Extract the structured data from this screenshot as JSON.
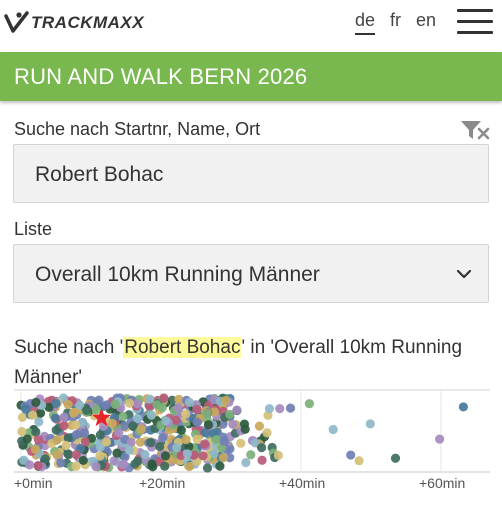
{
  "header": {
    "logo_text": "TRACKMAXX",
    "languages": [
      {
        "code": "de",
        "active": true
      },
      {
        "code": "fr",
        "active": false
      },
      {
        "code": "en",
        "active": false
      }
    ],
    "menu_icon": "hamburger-menu-icon"
  },
  "event": {
    "title": "RUN AND WALK BERN 2026",
    "accent_color": "#79b84f"
  },
  "search": {
    "label": "Suche nach Startnr, Name, Ort",
    "value": "Robert Bohac",
    "filter_icon": "filter-icon"
  },
  "list": {
    "label": "Liste",
    "selected": "Overall 10km Running Männer",
    "chevron_icon": "chevron-down-icon"
  },
  "result": {
    "prefix": "Suche nach '",
    "query": "Robert Bohac",
    "middle": "' in '",
    "list_name": "Overall 10km Running Männer",
    "suffix": "'",
    "highlight_color": "#fffa9c"
  },
  "chart_data": {
    "type": "scatter",
    "xlabel": "",
    "ylabel": "",
    "xlim": [
      -1,
      67
    ],
    "x_ticks": [
      {
        "value": 0,
        "label": "+0min"
      },
      {
        "value": 20,
        "label": "+20min"
      },
      {
        "value": 40,
        "label": "+40min"
      },
      {
        "value": 60,
        "label": "+60min"
      }
    ],
    "highlight": {
      "x": 11.5,
      "marker": "star",
      "color": "#e8232a"
    },
    "dot_colors": [
      "#4a7a9c",
      "#c9a85c",
      "#7bb07a",
      "#2c5a3e",
      "#b75a78",
      "#6f7fb3",
      "#d4c07a",
      "#8fb9c9",
      "#a58cc0",
      "#3e6d5f"
    ],
    "outliers_min": [
      38.5,
      41.2,
      44.6,
      47.1,
      48.3,
      49.9,
      53.5,
      59.8,
      63.2
    ]
  }
}
